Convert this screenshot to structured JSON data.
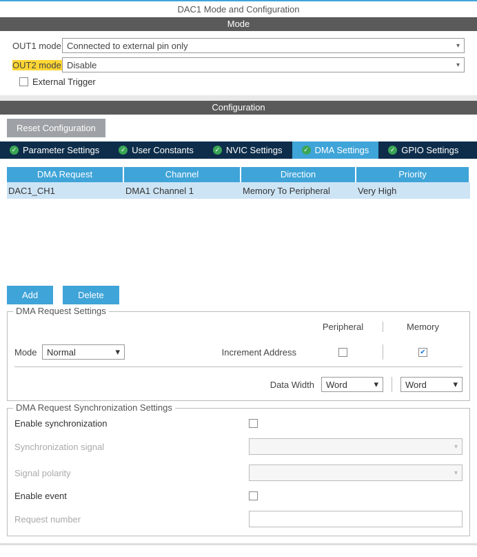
{
  "title": "DAC1 Mode and Configuration",
  "sections": {
    "mode": "Mode",
    "config": "Configuration"
  },
  "mode": {
    "out1_label": "OUT1 mode",
    "out1_value": "Connected to external pin only",
    "out2_label": "OUT2 mode",
    "out2_value": "Disable",
    "ext_trigger": "External Trigger",
    "ext_trigger_checked": false
  },
  "buttons": {
    "reset": "Reset Configuration",
    "add": "Add",
    "delete": "Delete"
  },
  "tabs": [
    {
      "label": "Parameter Settings",
      "active": false
    },
    {
      "label": "User Constants",
      "active": false
    },
    {
      "label": "NVIC Settings",
      "active": false
    },
    {
      "label": "DMA Settings",
      "active": true
    },
    {
      "label": "GPIO Settings",
      "active": false
    }
  ],
  "grid": {
    "headers": [
      "DMA Request",
      "Channel",
      "Direction",
      "Priority"
    ],
    "row": {
      "request": "DAC1_CH1",
      "channel": "DMA1 Channel 1",
      "direction": "Memory To Peripheral",
      "priority": "Very High"
    }
  },
  "req_settings": {
    "legend": "DMA Request Settings",
    "col_periph": "Peripheral",
    "col_mem": "Memory",
    "mode_label": "Mode",
    "mode_value": "Normal",
    "inc_addr_label": "Increment Address",
    "inc_periph_checked": false,
    "inc_mem_checked": true,
    "data_width_label": "Data Width",
    "dw_periph": "Word",
    "dw_mem": "Word"
  },
  "sync_settings": {
    "legend": "DMA Request Synchronization Settings",
    "enable_sync": "Enable synchronization",
    "enable_sync_checked": false,
    "sync_signal": "Synchronization signal",
    "signal_polarity": "Signal polarity",
    "enable_event": "Enable event",
    "enable_event_checked": false,
    "request_number": "Request number"
  }
}
